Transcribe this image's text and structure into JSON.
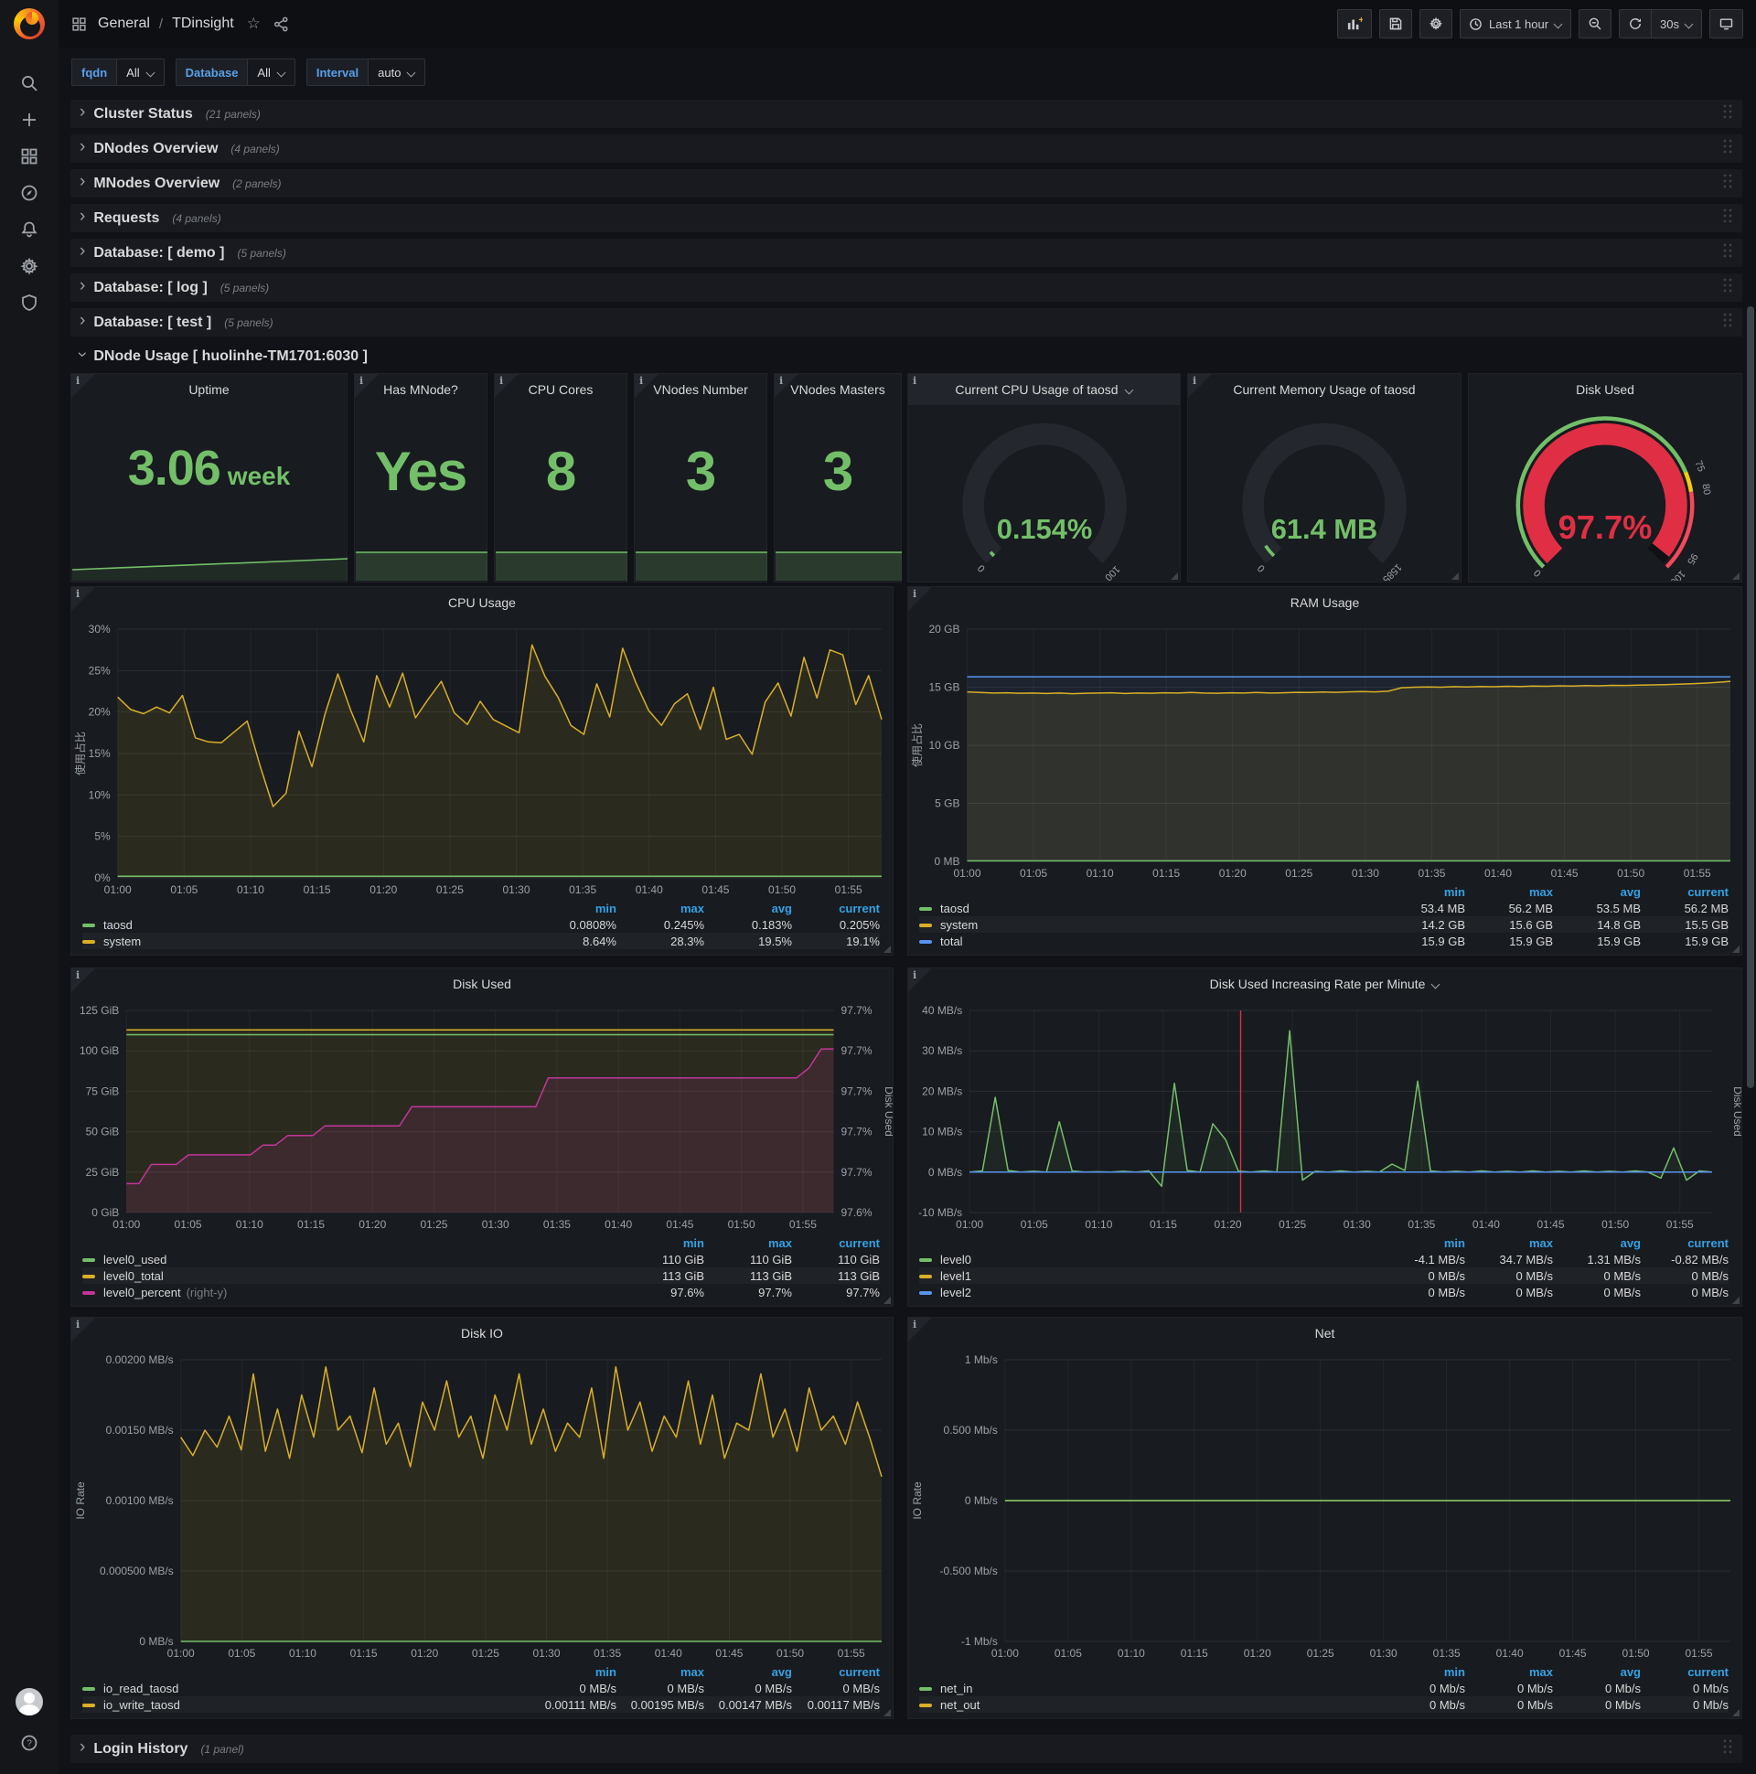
{
  "nav": {
    "breadcrumb_section": "General",
    "breadcrumb_sep": "/",
    "breadcrumb_page": "TDinsight",
    "time_range": "Last 1 hour",
    "refresh_interval": "30s"
  },
  "variables": [
    {
      "label": "fqdn",
      "value": "All"
    },
    {
      "label": "Database",
      "value": "All"
    },
    {
      "label": "Interval",
      "value": "auto"
    }
  ],
  "rows": [
    {
      "title": "Cluster Status",
      "count": "(21 panels)"
    },
    {
      "title": "DNodes Overview",
      "count": "(4 panels)"
    },
    {
      "title": "MNodes Overview",
      "count": "(2 panels)"
    },
    {
      "title": "Requests",
      "count": "(4 panels)"
    },
    {
      "title": "Database: [ demo ]",
      "count": "(5 panels)"
    },
    {
      "title": "Database: [ log ]",
      "count": "(5 panels)"
    },
    {
      "title": "Database: [ test ]",
      "count": "(5 panels)"
    }
  ],
  "expanded_row": {
    "title": "DNode Usage [ huolinhe-TM1701:6030 ]"
  },
  "footer_row": {
    "title": "Login History",
    "count": "(1 panel)"
  },
  "stats": [
    {
      "id": "uptime",
      "title": "Uptime",
      "value": "3.06",
      "unit": "week",
      "spark": "line"
    },
    {
      "id": "has-mnode",
      "title": "Has MNode?",
      "value": "Yes",
      "unit": "",
      "spark": "fill"
    },
    {
      "id": "cpu-cores",
      "title": "CPU Cores",
      "value": "8",
      "unit": "",
      "spark": "fill"
    },
    {
      "id": "vnodes-number",
      "title": "VNodes Number",
      "value": "3",
      "unit": "",
      "spark": "fill"
    },
    {
      "id": "vnodes-masters",
      "title": "VNodes Masters",
      "value": "3",
      "unit": "",
      "spark": "fill"
    }
  ],
  "gauges": [
    {
      "id": "cpu-gauge",
      "title": "Current CPU Usage of taosd",
      "has_menu": true,
      "value": "0.154%",
      "value_color": "#73bf69",
      "frac": 0.0154,
      "labels": [
        {
          "t": 0,
          "text": "0"
        },
        {
          "t": 1,
          "text": "100"
        }
      ],
      "style": "simple"
    },
    {
      "id": "mem-gauge",
      "title": "Current Memory Usage of taosd",
      "has_menu": false,
      "value": "61.4 MB",
      "value_color": "#73bf69",
      "frac": 0.039,
      "labels": [
        {
          "t": 0,
          "text": "0"
        },
        {
          "t": 1,
          "text": "1585"
        }
      ],
      "style": "simple"
    },
    {
      "id": "disk-gauge",
      "title": "Disk Used",
      "has_menu": false,
      "value": "97.7%",
      "value_color": "#e02f44",
      "frac": 0.977,
      "labels": [
        {
          "t": 0,
          "text": "0"
        },
        {
          "t": 0.75,
          "text": "75"
        },
        {
          "t": 0.8,
          "text": "80"
        },
        {
          "t": 0.95,
          "text": "95"
        },
        {
          "t": 1,
          "text": "100"
        }
      ],
      "style": "threshold",
      "thresholds": [
        {
          "to": 0.75,
          "color": "#73bf69"
        },
        {
          "to": 0.8,
          "color": "#f2cc0c"
        },
        {
          "to": 1,
          "color": "#f2495c"
        }
      ]
    }
  ],
  "time_axis": [
    "01:00",
    "01:05",
    "01:10",
    "01:15",
    "01:20",
    "01:25",
    "01:30",
    "01:35",
    "01:40",
    "01:45",
    "01:50",
    "01:55"
  ],
  "chart_data": [
    {
      "id": "cpu_usage",
      "type": "line",
      "title": "CPU Usage",
      "ylabel": "使用占比",
      "ylim": [
        0,
        30
      ],
      "yticks": [
        "30%",
        "25%",
        "20%",
        "15%",
        "10%",
        "5%",
        "0%"
      ],
      "grid": true,
      "legend_position": "bottom-table",
      "series": [
        {
          "name": "system",
          "color": "#d9af27",
          "fill": "rgba(217,175,39,0.10)",
          "values": [
            21.8,
            20.3,
            19.8,
            20.6,
            19.9,
            22,
            16.9,
            16.4,
            16.3,
            17.6,
            18.9,
            13.5,
            8.6,
            10.2,
            17.7,
            13.4,
            19.7,
            24.6,
            20.2,
            16.4,
            24.4,
            20.6,
            24.7,
            19.3,
            21.6,
            23.7,
            19.9,
            18.5,
            21.3,
            19.1,
            18.3,
            17.5,
            28.1,
            24.3,
            21.8,
            18.4,
            17.3,
            23.4,
            19.4,
            27.7,
            23.6,
            20.2,
            18.4,
            21,
            22.2,
            17.9,
            23,
            16.7,
            17.3,
            14.9,
            21.2,
            23.5,
            19.5,
            26.6,
            21.7,
            27.5,
            26.9,
            20.9,
            24.4,
            19.1
          ]
        },
        {
          "name": "taosd",
          "color": "#73bf69",
          "values": [
            0.2,
            0.2
          ]
        }
      ],
      "legend": {
        "cols": [
          "min",
          "max",
          "avg",
          "current"
        ],
        "rows": [
          {
            "name": "taosd",
            "color": "#73bf69",
            "vals": [
              "0.0808%",
              "0.245%",
              "0.183%",
              "0.205%"
            ]
          },
          {
            "name": "system",
            "color": "#d9af27",
            "vals": [
              "8.64%",
              "28.3%",
              "19.5%",
              "19.1%"
            ]
          }
        ]
      }
    },
    {
      "id": "ram_usage",
      "type": "line",
      "title": "RAM Usage",
      "ylabel": "使用占比",
      "ylim": [
        0,
        20
      ],
      "yticks": [
        "20 GB",
        "15 GB",
        "10 GB",
        "5 GB",
        "0 MB"
      ],
      "grid": true,
      "legend_position": "bottom-table",
      "series": [
        {
          "name": "total",
          "color": "#5794f2",
          "fill": "rgba(87,148,242,0.08)",
          "values": [
            15.9,
            15.9
          ]
        },
        {
          "name": "system",
          "color": "#d9af27",
          "fill": "rgba(217,175,39,0.10)",
          "values": [
            14.6,
            14.55,
            14.5,
            14.52,
            14.48,
            14.5,
            14.46,
            14.5,
            14.44,
            14.48,
            14.5,
            14.52,
            14.46,
            14.5,
            14.48,
            14.52,
            14.5,
            14.55,
            14.5,
            14.48,
            14.52,
            14.5,
            14.54,
            14.5,
            14.52,
            14.56,
            14.54,
            14.58,
            14.56,
            14.6,
            14.62,
            14.6,
            14.65,
            14.95,
            15,
            15.02,
            15,
            15.05,
            15.02,
            15.06,
            15.04,
            15.08,
            15.06,
            15.1,
            15.08,
            15.12,
            15.1,
            15.14,
            15.12,
            15.16,
            15.15,
            15.18,
            15.2,
            15.22,
            15.25,
            15.3,
            15.35,
            15.42,
            15.5
          ]
        },
        {
          "name": "taosd",
          "color": "#73bf69",
          "values": [
            0.05,
            0.05
          ]
        }
      ],
      "legend": {
        "cols": [
          "min",
          "max",
          "avg",
          "current"
        ],
        "rows": [
          {
            "name": "taosd",
            "color": "#73bf69",
            "vals": [
              "53.4 MB",
              "56.2 MB",
              "53.5 MB",
              "56.2 MB"
            ]
          },
          {
            "name": "system",
            "color": "#d9af27",
            "vals": [
              "14.2 GB",
              "15.6 GB",
              "14.8 GB",
              "15.5 GB"
            ]
          },
          {
            "name": "total",
            "color": "#5794f2",
            "vals": [
              "15.9 GB",
              "15.9 GB",
              "15.9 GB",
              "15.9 GB"
            ]
          }
        ]
      }
    },
    {
      "id": "disk_used",
      "type": "line",
      "title": "Disk Used",
      "ylim": [
        0,
        125
      ],
      "yticks": [
        "125 GiB",
        "100 GiB",
        "75 GiB",
        "50 GiB",
        "25 GiB",
        "0 GiB"
      ],
      "rlim": [
        97.55,
        97.76
      ],
      "rticks": [
        "97.7%",
        "97.7%",
        "97.7%",
        "97.7%",
        "97.7%",
        "97.6%"
      ],
      "rlabel": "Disk Used",
      "grid": true,
      "legend_position": "bottom-table",
      "series": [
        {
          "name": "level0_total",
          "color": "#d9af27",
          "fill": "rgba(217,175,39,0.10)",
          "values": [
            113,
            113
          ]
        },
        {
          "name": "level0_used",
          "color": "#73bf69",
          "values": [
            110,
            110
          ]
        },
        {
          "name": "level0_percent",
          "color": "#c23599",
          "axis": "right",
          "fill": "rgba(194,53,153,0.12)",
          "values": [
            97.58,
            97.58,
            97.6,
            97.6,
            97.6,
            97.61,
            97.61,
            97.61,
            97.61,
            97.61,
            97.61,
            97.62,
            97.62,
            97.63,
            97.63,
            97.63,
            97.64,
            97.64,
            97.64,
            97.64,
            97.64,
            97.64,
            97.64,
            97.66,
            97.66,
            97.66,
            97.66,
            97.66,
            97.66,
            97.66,
            97.66,
            97.66,
            97.66,
            97.66,
            97.69,
            97.69,
            97.69,
            97.69,
            97.69,
            97.69,
            97.69,
            97.69,
            97.69,
            97.69,
            97.69,
            97.69,
            97.69,
            97.69,
            97.69,
            97.69,
            97.69,
            97.69,
            97.69,
            97.69,
            97.69,
            97.7,
            97.72,
            97.72
          ]
        }
      ],
      "legend": {
        "cols": [
          "min",
          "max",
          "current"
        ],
        "rows": [
          {
            "name": "level0_used",
            "color": "#73bf69",
            "vals": [
              "110 GiB",
              "110 GiB",
              "110 GiB"
            ]
          },
          {
            "name": "level0_total",
            "color": "#d9af27",
            "vals": [
              "113 GiB",
              "113 GiB",
              "113 GiB"
            ]
          },
          {
            "name": "level0_percent",
            "color": "#c23599",
            "note": "(right-y)",
            "vals": [
              "97.6%",
              "97.7%",
              "97.7%"
            ]
          }
        ]
      }
    },
    {
      "id": "disk_rate",
      "type": "line",
      "title": "Disk Used Increasing Rate per Minute",
      "has_menu": true,
      "ylim": [
        -10,
        40
      ],
      "yticks": [
        "40 MB/s",
        "30 MB/s",
        "20 MB/s",
        "10 MB/s",
        "0 MB/s",
        "-10 MB/s"
      ],
      "rlabel": "Disk Used",
      "annotation": {
        "frac": 0.365,
        "color": "#e02f44"
      },
      "grid": true,
      "legend_position": "bottom-table",
      "series": [
        {
          "name": "level0",
          "color": "#73bf69",
          "fill": "rgba(115,191,105,0.08)",
          "values": [
            0,
            0.3,
            18.5,
            0.4,
            0,
            0.2,
            0,
            12.5,
            0.3,
            0,
            0.1,
            0,
            0.2,
            0,
            0.3,
            -3.5,
            22,
            0.4,
            0,
            12,
            8,
            0.2,
            0,
            0.3,
            0,
            35,
            -2,
            0.2,
            0,
            0.3,
            0,
            0.2,
            0,
            2,
            0.4,
            22.5,
            0.3,
            0,
            0.2,
            0,
            0.3,
            0,
            0.2,
            0,
            0.3,
            0,
            0.2,
            0,
            0.3,
            0,
            0.2,
            0,
            0.3,
            0,
            -1.5,
            6,
            -2,
            0.3,
            0
          ]
        },
        {
          "name": "level1",
          "color": "#d9af27",
          "values": [
            0,
            0
          ]
        },
        {
          "name": "level2",
          "color": "#5794f2",
          "values": [
            0,
            0
          ]
        }
      ],
      "legend": {
        "cols": [
          "min",
          "max",
          "avg",
          "current"
        ],
        "rows": [
          {
            "name": "level0",
            "color": "#73bf69",
            "vals": [
              "-4.1 MB/s",
              "34.7 MB/s",
              "1.31 MB/s",
              "-0.82 MB/s"
            ]
          },
          {
            "name": "level1",
            "color": "#d9af27",
            "vals": [
              "0 MB/s",
              "0 MB/s",
              "0 MB/s",
              "0 MB/s"
            ]
          },
          {
            "name": "level2",
            "color": "#5794f2",
            "vals": [
              "0 MB/s",
              "0 MB/s",
              "0 MB/s",
              "0 MB/s"
            ]
          }
        ]
      }
    },
    {
      "id": "disk_io",
      "type": "line",
      "title": "Disk IO",
      "ylabel": "IO Rate",
      "ylim": [
        0,
        0.002
      ],
      "yticks": [
        "0.00200 MB/s",
        "0.00150 MB/s",
        "0.00100 MB/s",
        "0.000500 MB/s",
        "0 MB/s"
      ],
      "grid": true,
      "legend_position": "bottom-table",
      "series": [
        {
          "name": "io_write_taosd",
          "color": "#d9af27",
          "fill": "rgba(217,175,39,0.10)",
          "values": [
            0.00145,
            0.00132,
            0.0015,
            0.00138,
            0.0016,
            0.00136,
            0.0019,
            0.00135,
            0.00165,
            0.0013,
            0.00175,
            0.00145,
            0.00195,
            0.0015,
            0.0016,
            0.00134,
            0.0018,
            0.0014,
            0.00155,
            0.00124,
            0.0017,
            0.0015,
            0.00185,
            0.00145,
            0.0016,
            0.0013,
            0.00175,
            0.0015,
            0.0019,
            0.0014,
            0.00165,
            0.00135,
            0.00155,
            0.00145,
            0.0018,
            0.0013,
            0.00195,
            0.0015,
            0.0017,
            0.00135,
            0.0016,
            0.00145,
            0.00185,
            0.0014,
            0.00175,
            0.0013,
            0.00155,
            0.0015,
            0.0019,
            0.00145,
            0.00165,
            0.00135,
            0.0018,
            0.0015,
            0.0016,
            0.0014,
            0.0017,
            0.00145,
            0.00117
          ]
        },
        {
          "name": "io_read_taosd",
          "color": "#73bf69",
          "values": [
            0,
            0
          ]
        }
      ],
      "legend": {
        "cols": [
          "min",
          "max",
          "avg",
          "current"
        ],
        "rows": [
          {
            "name": "io_read_taosd",
            "color": "#73bf69",
            "vals": [
              "0 MB/s",
              "0 MB/s",
              "0 MB/s",
              "0 MB/s"
            ]
          },
          {
            "name": "io_write_taosd",
            "color": "#d9af27",
            "vals": [
              "0.00111 MB/s",
              "0.00195 MB/s",
              "0.00147 MB/s",
              "0.00117 MB/s"
            ]
          }
        ]
      }
    },
    {
      "id": "net",
      "type": "line",
      "title": "Net",
      "ylabel": "IO Rate",
      "ylim": [
        -1,
        1
      ],
      "yticks": [
        "1 Mb/s",
        "0.500 Mb/s",
        "0 Mb/s",
        "-0.500 Mb/s",
        "-1 Mb/s"
      ],
      "grid": true,
      "legend_position": "bottom-table",
      "series": [
        {
          "name": "net_out",
          "color": "#d9af27",
          "values": [
            0,
            0
          ]
        },
        {
          "name": "net_in",
          "color": "#73bf69",
          "values": [
            0,
            0
          ]
        }
      ],
      "legend": {
        "cols": [
          "min",
          "max",
          "avg",
          "current"
        ],
        "rows": [
          {
            "name": "net_in",
            "color": "#73bf69",
            "vals": [
              "0 Mb/s",
              "0 Mb/s",
              "0 Mb/s",
              "0 Mb/s"
            ]
          },
          {
            "name": "net_out",
            "color": "#d9af27",
            "vals": [
              "0 Mb/s",
              "0 Mb/s",
              "0 Mb/s",
              "0 Mb/s"
            ]
          }
        ]
      }
    }
  ],
  "colors": {
    "page_bg": "#111217",
    "panel_bg": "#181b1f",
    "green": "#73bf69",
    "yellow": "#d9af27",
    "blue": "#5794f2",
    "magenta": "#c23599",
    "red": "#e02f44",
    "legend_header": "#33a2e5",
    "stat_value": "#73bf69",
    "gauge_track": "#24272d"
  }
}
